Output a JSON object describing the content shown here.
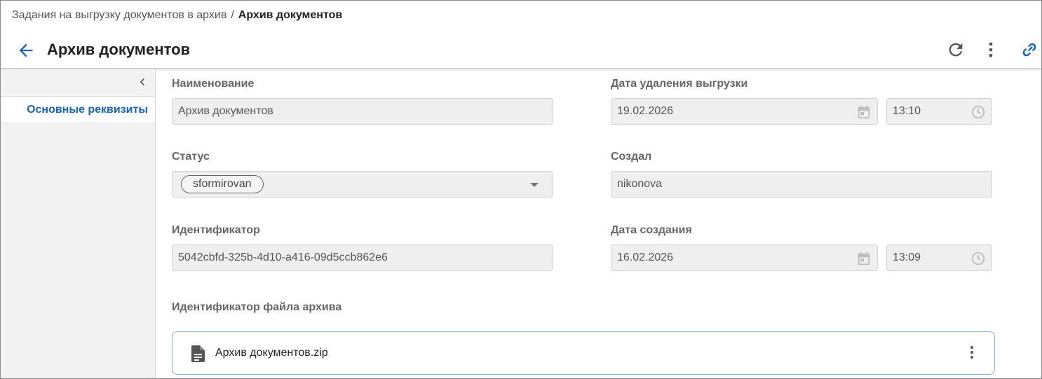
{
  "breadcrumb": {
    "parent": "Задания на выгрузку документов в архив",
    "separator": "/",
    "current": "Архив документов"
  },
  "header": {
    "title": "Архив документов",
    "icons": [
      "back-arrow-icon",
      "refresh-icon",
      "more-vertical-icon",
      "link-icon"
    ]
  },
  "sidebar": {
    "items": [
      {
        "label": "Основные реквизиты",
        "active": true
      }
    ]
  },
  "form": {
    "name": {
      "label": "Наименование",
      "value": "Архив документов"
    },
    "deletion_date": {
      "label": "Дата удаления выгрузки",
      "date": "19.02.2026",
      "time": "13:10"
    },
    "status": {
      "label": "Статус",
      "value": "sformirovan"
    },
    "created_by": {
      "label": "Создал",
      "value": "nikonova"
    },
    "identifier": {
      "label": "Идентификатор",
      "value": "5042cbfd-325b-4d10-a416-09d5ccb862e6"
    },
    "created_date": {
      "label": "Дата создания",
      "date": "16.02.2026",
      "time": "13:09"
    },
    "archive_file": {
      "label": "Идентификатор файла архива",
      "file_name": "Архив документов.zip"
    }
  },
  "colors": {
    "accent": "#1565c0",
    "field_bg": "#efefef",
    "sidebar_bg": "#f2f2f2",
    "file_card_border": "#8fb3d6"
  }
}
